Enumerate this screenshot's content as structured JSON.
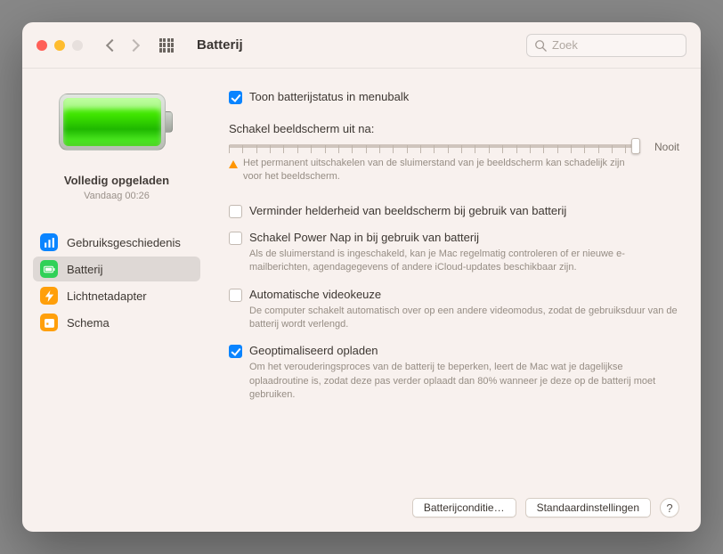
{
  "window": {
    "title": "Batterij"
  },
  "search": {
    "placeholder": "Zoek"
  },
  "sidebar": {
    "status_main": "Volledig opgeladen",
    "status_sub": "Vandaag 00:26",
    "nav": [
      {
        "label": "Gebruiksgeschiedenis"
      },
      {
        "label": "Batterij"
      },
      {
        "label": "Lichtnetadapter"
      },
      {
        "label": "Schema"
      }
    ]
  },
  "main": {
    "show_menubar_label": "Toon batterijstatus in menubalk",
    "display_off_label": "Schakel beeldscherm uit na:",
    "slider_end_label": "Nooit",
    "warn_text": "Het permanent uitschakelen van de sluimerstand van je beeldscherm kan schadelijk zijn voor het beeldscherm.",
    "options": [
      {
        "label": "Verminder helderheid van beeldscherm bij gebruik van batterij",
        "help": "",
        "checked": false
      },
      {
        "label": "Schakel Power Nap in bij gebruik van batterij",
        "help": "Als de sluimerstand is ingeschakeld, kan je Mac regelmatig controleren of er nieuwe e-mailberichten, agendagegevens of andere iCloud-updates beschikbaar zijn.",
        "checked": false
      },
      {
        "label": "Automatische videokeuze",
        "help": "De computer schakelt automatisch over op een andere videomodus, zodat de gebruiksduur van de batterij wordt verlengd.",
        "checked": false
      },
      {
        "label": "Geoptimaliseerd opladen",
        "help": "Om het verouderingsproces van de batterij te beperken, leert de Mac wat je dagelijkse oplaadroutine is, zodat deze pas verder oplaadt dan 80% wanneer je deze op de batterij moet gebruiken.",
        "checked": true
      }
    ]
  },
  "footer": {
    "condition_label": "Batterijconditie…",
    "defaults_label": "Standaardinstellingen",
    "help_label": "?"
  }
}
